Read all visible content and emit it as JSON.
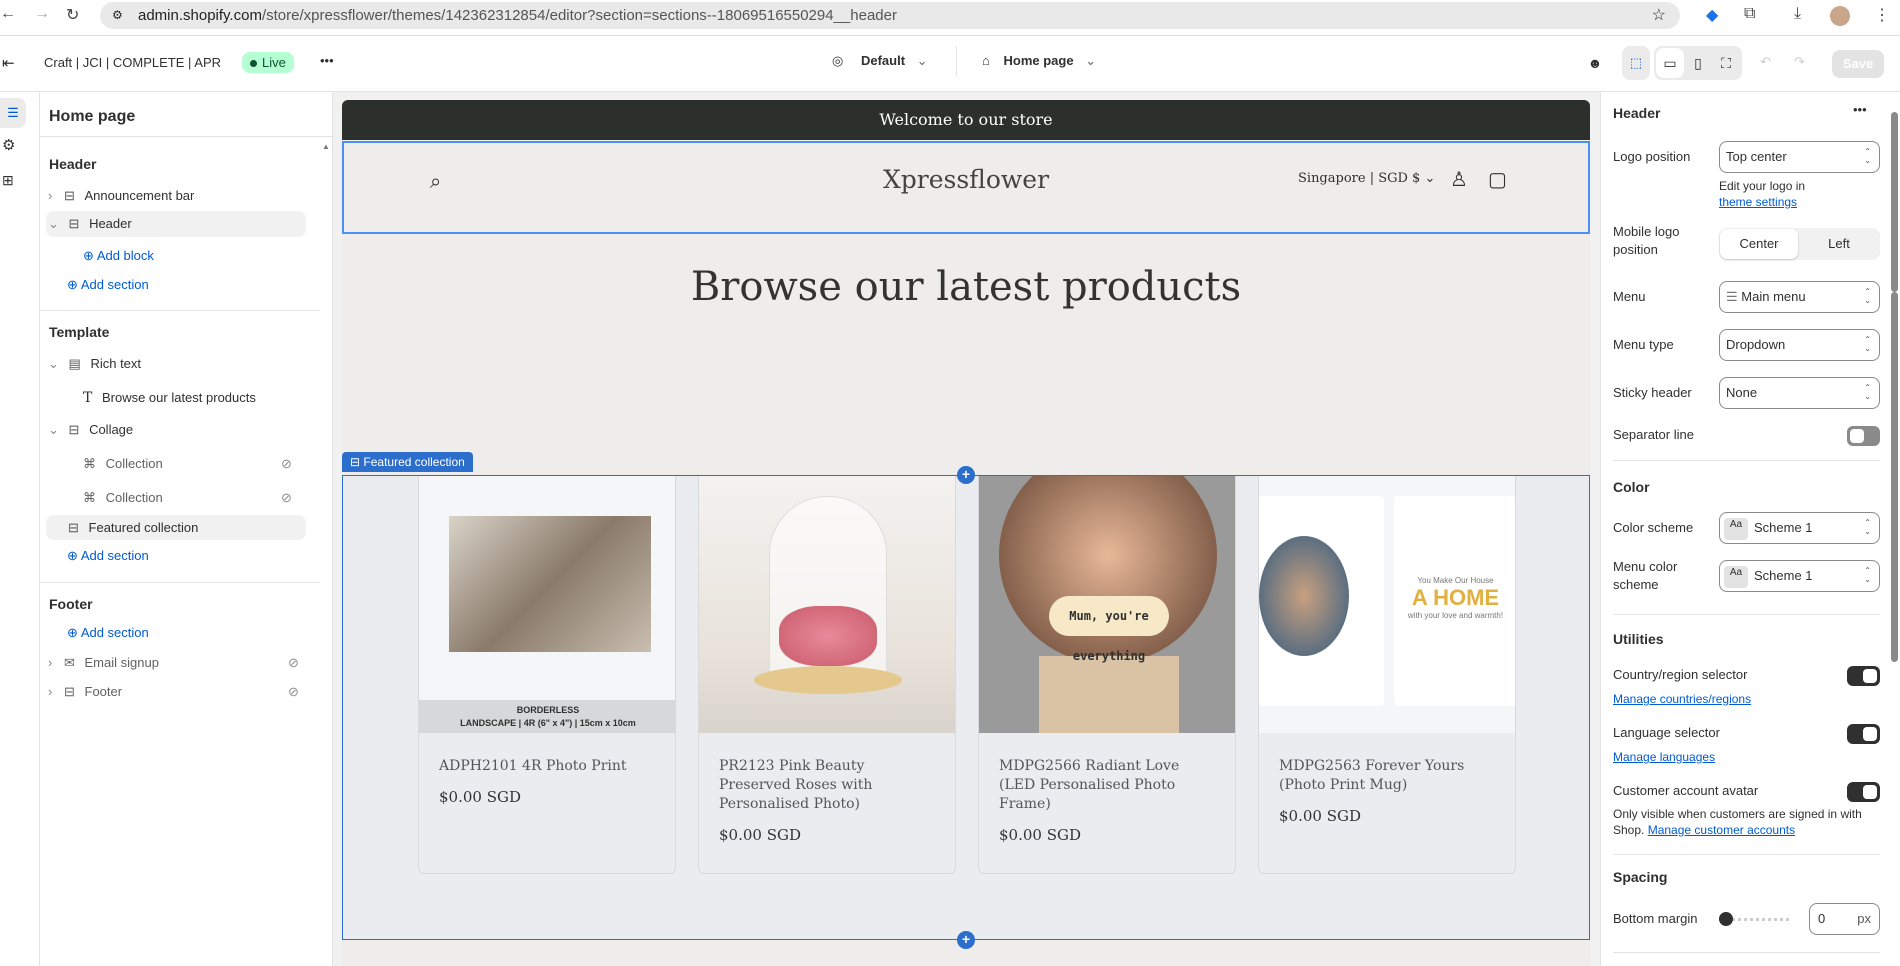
{
  "browser": {
    "url_host": "admin.shopify.com",
    "url_path": "/store/xpressflower/themes/142362312854/editor?section=sections--18069516550294__header"
  },
  "topbar": {
    "theme_name": "Craft | JCI | COMPLETE | APR",
    "status": "Live",
    "more": "•••",
    "view": "Default",
    "page": "Home page",
    "save": "Save"
  },
  "sidebar": {
    "title": "Home page",
    "header_group": {
      "heading": "Header",
      "items": [
        {
          "label": "Announcement bar"
        },
        {
          "label": "Header"
        }
      ],
      "add_block": "Add block",
      "add_section": "Add section"
    },
    "template_group": {
      "heading": "Template",
      "rich_text": "Rich text",
      "rich_text_child": "Browse our latest products",
      "collage": "Collage",
      "collage_children": [
        {
          "label": "Collection"
        },
        {
          "label": "Collection"
        }
      ],
      "featured": "Featured collection",
      "add_section": "Add section"
    },
    "footer_group": {
      "heading": "Footer",
      "add_section": "Add section",
      "items": [
        {
          "label": "Email signup"
        },
        {
          "label": "Footer"
        }
      ]
    }
  },
  "preview": {
    "announcement": "Welcome to our store",
    "logo": "Xpressflower",
    "localization": "Singapore | SGD $",
    "heading": "Browse our latest products",
    "section_tag": "Featured collection",
    "products": [
      {
        "title": "ADPH2101 4R Photo Print",
        "price": "$0.00 SGD",
        "image_text_1": "BORDERLESS",
        "image_text_2": "LANDSCAPE | 4R (6\" x 4\") | 15cm x 10cm"
      },
      {
        "title": "PR2123 Pink Beauty Preserved Roses with Personalised Photo)",
        "price": "$0.00 SGD"
      },
      {
        "title": "MDPG2566 Radiant Love (LED Personalised Photo Frame)",
        "price": "$0.00 SGD",
        "image_text_1": "Mum, you're everything"
      },
      {
        "title": "MDPG2563 Forever Yours (Photo Print Mug)",
        "price": "$0.00 SGD",
        "image_text_1": "You Make Our House",
        "image_text_2": "A HOME",
        "image_text_3": "with your love and warmth!"
      }
    ]
  },
  "settings": {
    "title": "Header",
    "more": "•••",
    "logo_position": {
      "label": "Logo position",
      "value": "Top center",
      "help": "Edit your logo in",
      "link": "theme settings"
    },
    "mobile_logo": {
      "label": "Mobile logo position",
      "options": [
        "Center",
        "Left"
      ],
      "selected": "Center"
    },
    "menu": {
      "label": "Menu",
      "value": "Main menu"
    },
    "menu_type": {
      "label": "Menu type",
      "value": "Dropdown"
    },
    "sticky": {
      "label": "Sticky header",
      "value": "None"
    },
    "separator": {
      "label": "Separator line",
      "on": false
    },
    "color": {
      "heading": "Color",
      "scheme_label": "Color scheme",
      "scheme_value": "Scheme 1",
      "menu_scheme_label": "Menu color scheme",
      "menu_scheme_value": "Scheme 1",
      "swatch": "Aa"
    },
    "utilities": {
      "heading": "Utilities",
      "country": "Country/region selector",
      "country_link": "Manage countries/regions",
      "language": "Language selector",
      "language_link": "Manage languages",
      "avatar": "Customer account avatar",
      "avatar_help": "Only visible when customers are signed in with Shop.",
      "avatar_link": "Manage customer accounts"
    },
    "spacing": {
      "heading": "Spacing",
      "bottom_margin": "Bottom margin",
      "value": "0",
      "unit": "px",
      "slider_value": 0
    }
  },
  "colors": {
    "accent": "#2c6ecb",
    "link": "#005bd3",
    "announcement_bg": "#2b302d",
    "live_bg": "#b4fed2"
  }
}
